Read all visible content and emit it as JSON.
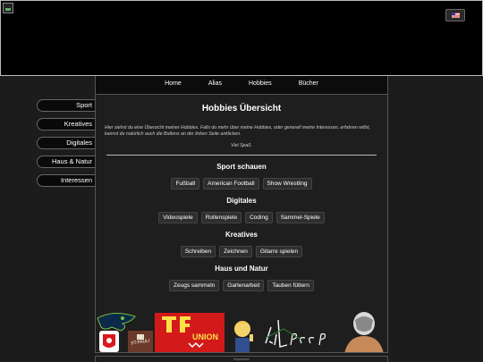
{
  "header": {
    "lang_button": "🇺🇸"
  },
  "topnav": {
    "items": [
      "Home",
      "Alias",
      "Hobbies",
      "Bücher"
    ]
  },
  "sidebar": {
    "items": [
      "Sport",
      "Kreatives",
      "Digitales",
      "Haus & Natur",
      "Interessen"
    ]
  },
  "main": {
    "title": "Hobbies Übersicht",
    "intro": "Hier siehst du eine Übersicht meiner Hobbies. Falls du mehr über meine Hobbies, oder generell meine Interessen, erfahren willst, kannst du natürlich auch die Buttons an der linken Seite anklicken.",
    "sign_off": "Viel Spaß.",
    "sections": [
      {
        "title": "Sport schauen",
        "tags": [
          "Fußball",
          "American Football",
          "Show Wrestling"
        ]
      },
      {
        "title": "Digitales",
        "tags": [
          "Videospiele",
          "Rollenspiele",
          "Coding",
          "Sammel-Spiele"
        ]
      },
      {
        "title": "Kreatives",
        "tags": [
          "Schreiben",
          "Zeichnen",
          "Gitarre spielen"
        ]
      },
      {
        "title": "Haus und Natur",
        "tags": [
          "Zeugs sammeln",
          "Gartenarbeit",
          "Tauben füttern"
        ]
      }
    ],
    "logos": [
      "seattle-seahawks-logo",
      "southampton-logo",
      "st-pauli-logo",
      "union-berlin-logo",
      "vault-boy-icon",
      "lil-peep-tag",
      "wrestler-image"
    ]
  },
  "footer": {
    "text": "Impressum"
  },
  "colors": {
    "background": "#1c1c1c",
    "panel": "#1e1e1e",
    "union_red": "#d21a1a"
  }
}
